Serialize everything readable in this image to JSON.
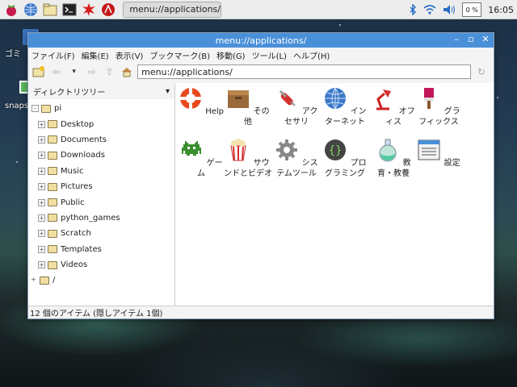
{
  "taskbar": {
    "task_label": "menu://applications/",
    "cpu": "0 %",
    "clock": "16:05"
  },
  "desktop": {
    "icons": [
      {
        "label": "ゴミ"
      },
      {
        "label": "snaps"
      }
    ]
  },
  "window": {
    "title": "menu://applications/",
    "menu": [
      "ファイル(F)",
      "編集(E)",
      "表示(V)",
      "ブックマーク(B)",
      "移動(G)",
      "ツール(L)",
      "ヘルプ(H)"
    ],
    "address": "menu://applications/",
    "sidebar_title": "ディレクトリツリー",
    "tree": [
      {
        "label": "pi",
        "expander": "-"
      },
      {
        "label": "Desktop",
        "expander": "+"
      },
      {
        "label": "Documents",
        "expander": "+"
      },
      {
        "label": "Downloads",
        "expander": "+"
      },
      {
        "label": "Music",
        "expander": "+"
      },
      {
        "label": "Pictures",
        "expander": "+"
      },
      {
        "label": "Public",
        "expander": "+"
      },
      {
        "label": "python_games",
        "expander": "+"
      },
      {
        "label": "Scratch",
        "expander": "+"
      },
      {
        "label": "Templates",
        "expander": "+"
      },
      {
        "label": "Videos",
        "expander": "+"
      },
      {
        "label": "/",
        "expander": "+"
      }
    ],
    "items": [
      {
        "label": "Help",
        "icon": "lifebuoy-icon"
      },
      {
        "label": "その他",
        "icon": "box-icon"
      },
      {
        "label": "アクセサリ",
        "icon": "swiss-knife-icon"
      },
      {
        "label": "インターネット",
        "icon": "globe-icon"
      },
      {
        "label": "オフィス",
        "icon": "desk-lamp-icon"
      },
      {
        "label": "グラフィックス",
        "icon": "paint-brush-icon"
      },
      {
        "label": "ゲーム",
        "icon": "space-invader-icon"
      },
      {
        "label": "サウンドとビデオ",
        "icon": "popcorn-icon"
      },
      {
        "label": "システムツール",
        "icon": "gear-icon"
      },
      {
        "label": "プログラミング",
        "icon": "code-braces-icon"
      },
      {
        "label": "教育・教養",
        "icon": "flask-icon"
      },
      {
        "label": "設定",
        "icon": "settings-panel-icon"
      }
    ],
    "status": "12 個のアイテム (隠しアイテム 1個)"
  }
}
